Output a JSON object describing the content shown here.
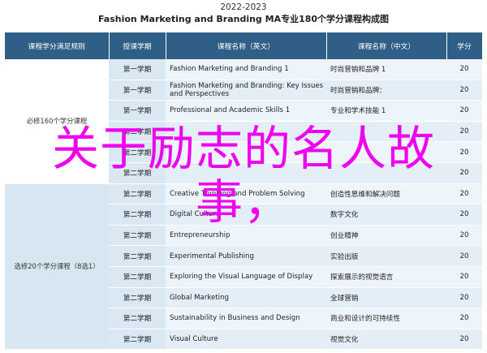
{
  "header": {
    "year": "2022-2023",
    "title": "Fashion Marketing and Branding MA专业180个学分课程构成图"
  },
  "columns": [
    "课程学分满足规则",
    "授课学期",
    "课程名称（英文）",
    "课程名称（中文）",
    "学分"
  ],
  "groups": [
    {
      "label": "必修160个学分课程",
      "rows": [
        {
          "sem": "第一学期",
          "en": "Fashion Marketing and Branding 1",
          "cn": "时尚营销和品牌 1",
          "cr": "20"
        },
        {
          "sem": "第一学期",
          "en": "Fashion Marketing and Branding: Key Issues and Perspectives",
          "cn": "时尚营销和品牌：",
          "cr": "20"
        },
        {
          "sem": "第一学期",
          "en": "Professional and Academic Skills 1",
          "cn": "专业和学术技能 1",
          "cr": "20"
        },
        {
          "sem": "第二学期",
          "en": "",
          "cn": "",
          "cr": "20"
        },
        {
          "sem": "第二学期",
          "en": "",
          "cn": "",
          "cr": "20"
        },
        {
          "sem": "第二学期",
          "en": "",
          "cn": "",
          "cr": "20"
        }
      ]
    },
    {
      "label": "选修20个学分课程（8选1）",
      "rows": [
        {
          "sem": "第二学期",
          "en": "Creative Thinking and Problem Solving",
          "cn": "创造性思维和解决问题",
          "cr": "20"
        },
        {
          "sem": "第二学期",
          "en": "Digital Culture",
          "cn": "数字文化",
          "cr": "20"
        },
        {
          "sem": "第二学期",
          "en": "Entrepreneurship",
          "cn": "创业精神",
          "cr": "20"
        },
        {
          "sem": "第二学期",
          "en": "Experimental Publishing",
          "cn": "实验出版",
          "cr": "20"
        },
        {
          "sem": "第二学期",
          "en": "Exploring the Visual Language of Display",
          "cn": "探索展示的视觉语言",
          "cr": "20"
        },
        {
          "sem": "第二学期",
          "en": "Global Marketing",
          "cn": "全球营销",
          "cr": "20"
        },
        {
          "sem": "第二学期",
          "en": "Sustainability in Business and Design",
          "cn": "商业和设计的可持续性",
          "cr": "20"
        },
        {
          "sem": "第二学期",
          "en": "Visual Culture",
          "cn": "视觉文化",
          "cr": "20"
        }
      ]
    }
  ],
  "overlay": {
    "line1": "关于励志的名人故",
    "line2": "事，"
  }
}
